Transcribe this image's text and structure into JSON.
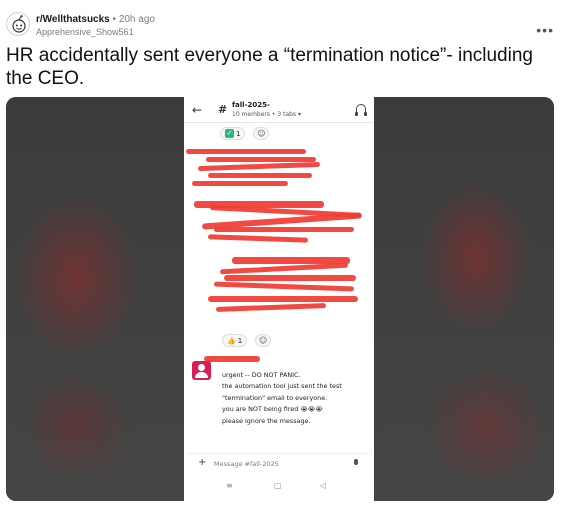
{
  "post": {
    "subreddit": "r/Wellthatsucks",
    "separator": "•",
    "age": "20h ago",
    "author": "Apprehensive_Show561",
    "more_icon": "more-options-icon",
    "title": "HR accidentally sent everyone a “termination notice”- including the CEO."
  },
  "screenshot": {
    "back_icon": "back-arrow-icon",
    "hash": "#",
    "channel_name": "fall-2025-",
    "channel_meta": "10 members • 3 tabs ▾",
    "headphones_icon": "headphones-icon",
    "reaction_top": {
      "emoji": "✓",
      "count": "1"
    },
    "reaction_bottom": {
      "emoji": "👍",
      "count": "1"
    },
    "add_reaction": "☺",
    "message_lines": [
      "urgent -- DO NOT PANIC.",
      "the automation tool just sent the test",
      "\"termination\" email to everyone.",
      "you are NOT being fired 😭😭😭",
      "please ignore the message."
    ],
    "composer": {
      "plus": "+",
      "placeholder": "Message #fall-2025"
    },
    "navbar": {
      "menu": "≡",
      "home": "▢",
      "back": "◁"
    }
  },
  "colors": {
    "redaction": "#ef3b33",
    "slack_green": "#2eb67d",
    "avatar": "#d81e5b"
  }
}
